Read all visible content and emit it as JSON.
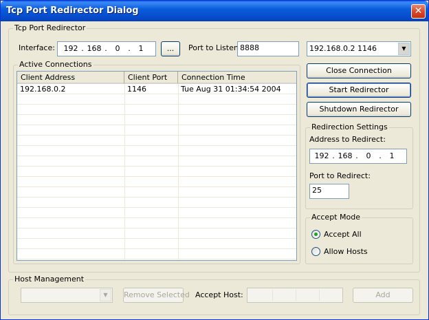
{
  "window": {
    "title": "Tcp Port Redirector Dialog",
    "close_glyph": "✕"
  },
  "redirector": {
    "group_label": "Tcp Port Redirector",
    "interface_label": "Interface:",
    "interface_ip": [
      "192",
      "168",
      "0",
      "1"
    ],
    "browse_label": "...",
    "port_label": "Port to Listen:",
    "port_value": "8888",
    "connection_select": "192.168.0.2 1146"
  },
  "connections": {
    "group_label": "Active Connections",
    "columns": [
      "Client Address",
      "Client Port",
      "Connection Time"
    ],
    "rows": [
      {
        "address": "192.168.0.2",
        "port": "1146",
        "time": "Tue Aug 31 01:34:54 2004"
      }
    ]
  },
  "buttons": {
    "close_connection": "Close Connection",
    "start_redirector": "Start Redirector",
    "shutdown_redirector": "Shutdown Redirector"
  },
  "settings": {
    "group_label": "Redirection Settings",
    "address_label": "Address to Redirect:",
    "address_ip": [
      "192",
      "168",
      "0",
      "1"
    ],
    "port_label": "Port to Redirect:",
    "port_value": "25"
  },
  "accept_mode": {
    "group_label": "Accept Mode",
    "accept_all": "Accept All",
    "allow_hosts": "Allow Hosts",
    "selected": "accept_all"
  },
  "host_management": {
    "group_label": "Host Management",
    "remove_selected": "Remove Selected",
    "accept_host_label": "Accept Host:",
    "add": "Add"
  },
  "colors": {
    "titlebar": "#0a5fe0",
    "face": "#ece9d8",
    "border": "#7f9db9",
    "close": "#d8442a"
  }
}
